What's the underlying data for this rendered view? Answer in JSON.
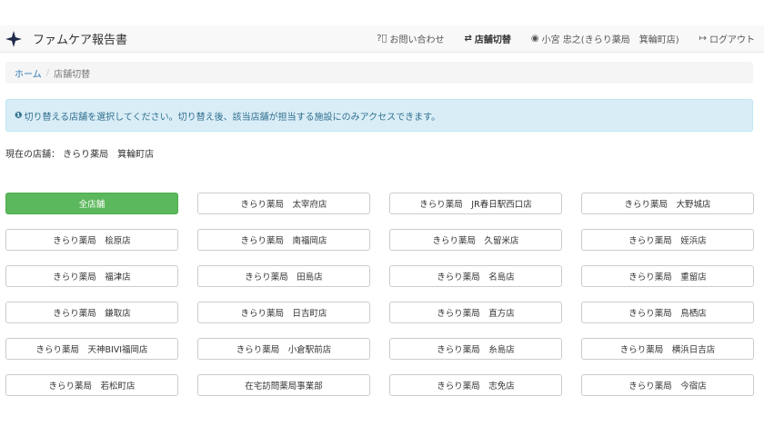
{
  "app": {
    "title": "ファムケア報告書"
  },
  "nav": {
    "contact": {
      "icon": "question-circle-icon",
      "label": "お問い合わせ"
    },
    "switch_store": {
      "icon": "exchange-icon",
      "label": "店舗切替"
    },
    "user": {
      "icon": "user-circle-icon",
      "label": "小宮 忠之(きらり薬局　箕輪町店)"
    },
    "logout": {
      "icon": "sign-out-icon",
      "label": "ログアウト"
    }
  },
  "breadcrumb": {
    "home": "ホーム",
    "separator": "/",
    "current": "店舗切替"
  },
  "alert": {
    "icon": "info-circle-icon",
    "text": "切り替える店舗を選択してください。切り替え後、該当店舗が担当する施設にのみアクセスできます。"
  },
  "current_store": {
    "text": "現在の店舗： きらり薬局　箕輪町店"
  },
  "stores": [
    "全店舗",
    "きらり薬局　太宰府店",
    "きらり薬局　JR春日駅西口店",
    "きらり薬局　大野城店",
    "きらり薬局　桧原店",
    "きらり薬局　南福岡店",
    "きらり薬局　久留米店",
    "きらり薬局　姪浜店",
    "きらり薬局　福津店",
    "きらり薬局　田島店",
    "きらり薬局　名島店",
    "きらり薬局　重留店",
    "きらり薬局　鎌取店",
    "きらり薬局　日吉町店",
    "きらり薬局　直方店",
    "きらり薬局　鳥栖店",
    "きらり薬局　天神BIVI福岡店",
    "きらり薬局　小倉駅前店",
    "きらり薬局　糸島店",
    "きらり薬局　横浜日吉店",
    "きらり薬局　若松町店",
    "在宅訪問薬局事業部",
    "きらり薬局　志免店",
    "きらり薬局　今宿店"
  ],
  "colors": {
    "primary": "#5cb85c",
    "link": "#337ab7",
    "alert_bg": "#d9edf7",
    "alert_text": "#31708f"
  }
}
